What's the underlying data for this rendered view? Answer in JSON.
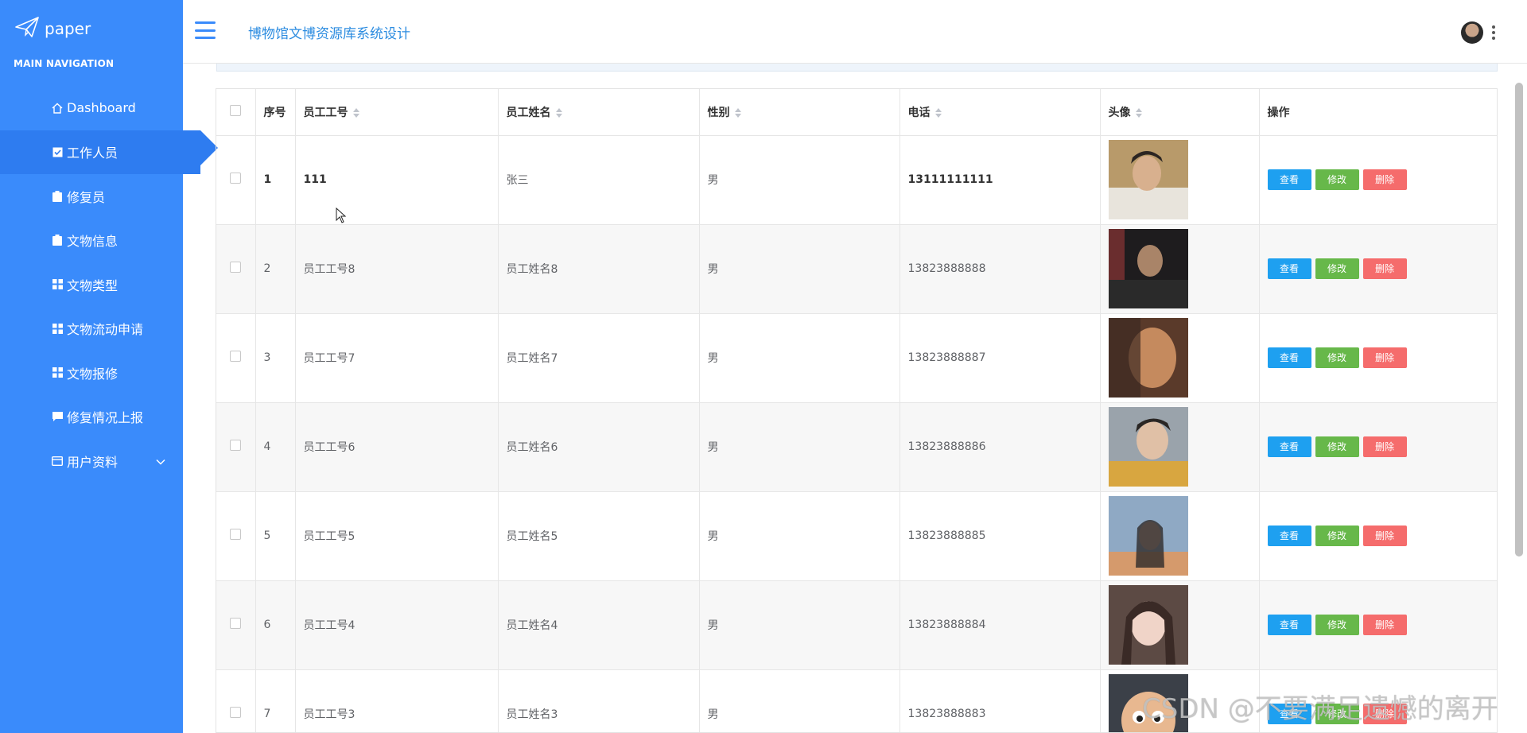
{
  "sidebar": {
    "logo_text": "paper",
    "nav_title": "MAIN NAVIGATION",
    "items": [
      {
        "label": "Dashboard",
        "icon": "home-icon"
      },
      {
        "label": "工作人员",
        "icon": "check-square-icon"
      },
      {
        "label": "修复员",
        "icon": "clipboard-icon"
      },
      {
        "label": "文物信息",
        "icon": "clipboard-icon"
      },
      {
        "label": "文物类型",
        "icon": "grid-icon"
      },
      {
        "label": "文物流动申请",
        "icon": "grid-icon"
      },
      {
        "label": "文物报修",
        "icon": "grid-icon"
      },
      {
        "label": "修复情况上报",
        "icon": "comment-icon"
      },
      {
        "label": "用户资料",
        "icon": "card-icon"
      }
    ]
  },
  "topbar": {
    "title": "博物馆文博资源库系统设计"
  },
  "table": {
    "headers": [
      "序号",
      "员工工号",
      "员工姓名",
      "性别",
      "电话",
      "头像",
      "操作"
    ],
    "rows": [
      {
        "no": "1",
        "id": "111",
        "name": "张三",
        "gender": "男",
        "phone": "13111111111"
      },
      {
        "no": "2",
        "id": "员工工号8",
        "name": "员工姓名8",
        "gender": "男",
        "phone": "13823888888"
      },
      {
        "no": "3",
        "id": "员工工号7",
        "name": "员工姓名7",
        "gender": "男",
        "phone": "13823888887"
      },
      {
        "no": "4",
        "id": "员工工号6",
        "name": "员工姓名6",
        "gender": "男",
        "phone": "13823888886"
      },
      {
        "no": "5",
        "id": "员工工号5",
        "name": "员工姓名5",
        "gender": "男",
        "phone": "13823888885"
      },
      {
        "no": "6",
        "id": "员工工号4",
        "name": "员工姓名4",
        "gender": "男",
        "phone": "13823888884"
      },
      {
        "no": "7",
        "id": "员工工号3",
        "name": "员工姓名3",
        "gender": "男",
        "phone": "13823888883"
      }
    ],
    "actions": {
      "view": "查看",
      "edit": "修改",
      "delete": "删除"
    }
  },
  "watermark": "CSDN @不要满足遗憾的离开",
  "colors": {
    "sidebar": "#3a8bfb",
    "sidebar_active": "#2e7cf0",
    "title": "#2c8ce0",
    "view": "#1ea0f0",
    "edit": "#67b84a",
    "delete": "#f56c6c"
  }
}
